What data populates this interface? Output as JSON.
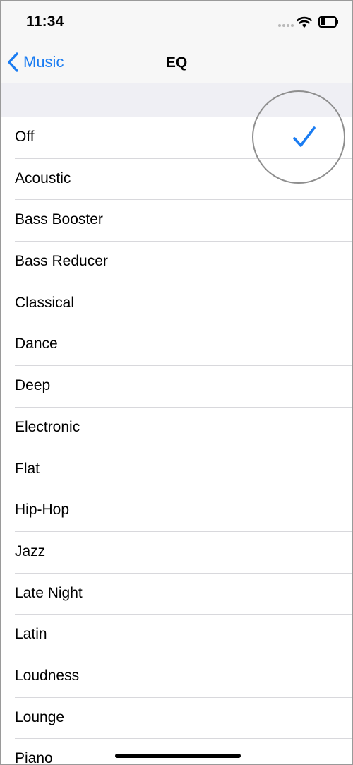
{
  "status_bar": {
    "time": "11:34"
  },
  "nav": {
    "back_label": "Music",
    "title": "EQ"
  },
  "eq": {
    "selected": "Off",
    "options": [
      "Off",
      "Acoustic",
      "Bass Booster",
      "Bass Reducer",
      "Classical",
      "Dance",
      "Deep",
      "Electronic",
      "Flat",
      "Hip-Hop",
      "Jazz",
      "Late Night",
      "Latin",
      "Loudness",
      "Lounge",
      "Piano"
    ]
  },
  "colors": {
    "accent": "#1a7cf2",
    "bar_bg": "#f7f7f7",
    "group_bg": "#efeff4"
  },
  "icons": {
    "back": "chevron-left-icon",
    "selected": "checkmark-icon",
    "wifi": "wifi-icon",
    "battery": "battery-icon"
  }
}
